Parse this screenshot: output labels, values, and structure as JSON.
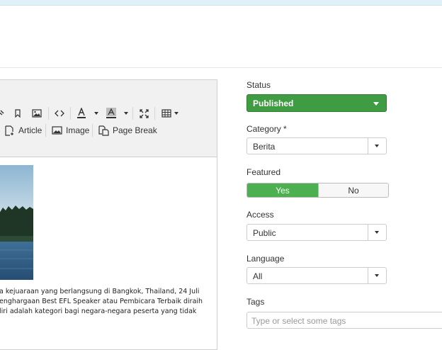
{
  "editor": {
    "toolbar_row2": {
      "article": "Article",
      "image": "Image",
      "page_break": "Page Break"
    },
    "body_lines": [
      "a kejuaraan yang berlangsung di Bangkok, Thailand, 24 Juli",
      "enghargaan Best EFL Speaker atau Pembicara Terbaik diraih",
      "liri adalah kategori bagi negara-negara peserta yang tidak"
    ]
  },
  "sidebar": {
    "status": {
      "label": "Status",
      "value": "Published",
      "color": "#3f9c42"
    },
    "category": {
      "label": "Category *",
      "value": "Berita"
    },
    "featured": {
      "label": "Featured",
      "yes": "Yes",
      "no": "No",
      "selected": "Yes"
    },
    "access": {
      "label": "Access",
      "value": "Public"
    },
    "language": {
      "label": "Language",
      "value": "All"
    },
    "tags": {
      "label": "Tags",
      "placeholder": "Type or select some tags"
    }
  }
}
